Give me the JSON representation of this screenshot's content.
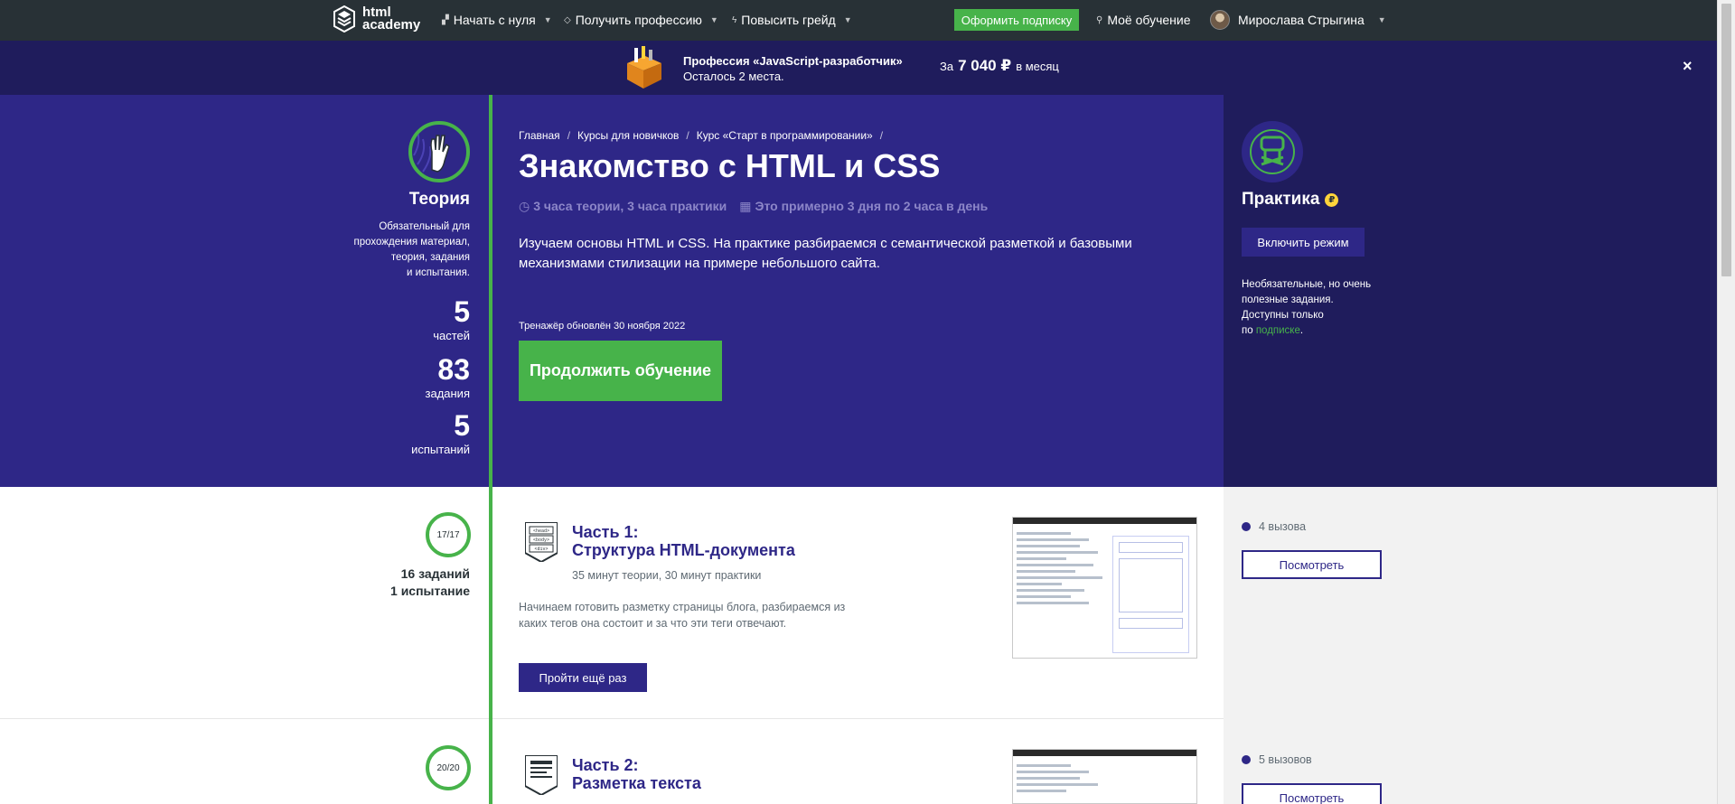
{
  "nav": {
    "logo_line1": "html",
    "logo_line2": "academy",
    "items": [
      {
        "label": "Начать с нуля"
      },
      {
        "label": "Получить профессию"
      },
      {
        "label": "Повысить грейд"
      }
    ],
    "subscribe_label": "Оформить подписку",
    "my_learning_label": "Моё обучение",
    "user_name": "Мирослава Стрыгина"
  },
  "promo": {
    "title": "Профессия «JavaScript-разработчик»",
    "subtitle": "Осталось 2 места.",
    "price_prefix": "За",
    "price_value": "7 040 ₽",
    "price_suffix": "в месяц",
    "close_label": "×"
  },
  "theory": {
    "title": "Теория",
    "desc_lines": [
      "Обязательный для",
      "прохождения материал,",
      "теория, задания",
      "и испытания."
    ],
    "stats": [
      {
        "value": "5",
        "label": "частей"
      },
      {
        "value": "83",
        "label": "задания"
      },
      {
        "value": "5",
        "label": "испытаний"
      }
    ]
  },
  "course": {
    "breadcrumbs": [
      "Главная",
      "Курсы для новичков",
      "Курс «Старт в программировании»"
    ],
    "title": "Знакомство с HTML и CSS",
    "meta_time": "3 часа теории, 3 часа практики",
    "meta_schedule": "Это примерно 3 дня по 2 часа в день",
    "lead": "Изучаем основы HTML и CSS. На практике разбираемся с семантической разметкой и базовыми механизмами стилизации на примере небольшого сайта.",
    "updated": "Тренажёр обновлён 30 ноября 2022",
    "continue_label": "Продолжить обучение"
  },
  "practice": {
    "title": "Практика",
    "coin": "₽",
    "mode_label": "Включить режим",
    "desc_lines": [
      "Необязательные, но очень",
      "полезные задания.",
      "Доступны только"
    ],
    "desc_last_prefix": "по",
    "desc_link": "подписке",
    "desc_last_suffix": "."
  },
  "parts": [
    {
      "progress": "17/17",
      "tasks": "16 заданий",
      "trials": "1 испытание",
      "number": "Часть 1:",
      "name": "Структура HTML-документа",
      "time": "35 минут теории, 30 минут практики",
      "desc": "Начинаем готовить разметку страницы блога, разбираемся из каких тегов она состоит и за что эти теги отвечают.",
      "retry_label": "Пройти ещё раз",
      "challenges": "4 вызова",
      "view_label": "Посмотреть",
      "icon_tags": [
        "<head>",
        "<body>",
        "<div>"
      ]
    },
    {
      "progress": "20/20",
      "number": "Часть 2:",
      "name": "Разметка текста",
      "challenges": "5 вызовов",
      "view_label": "Посмотреть"
    }
  ]
}
